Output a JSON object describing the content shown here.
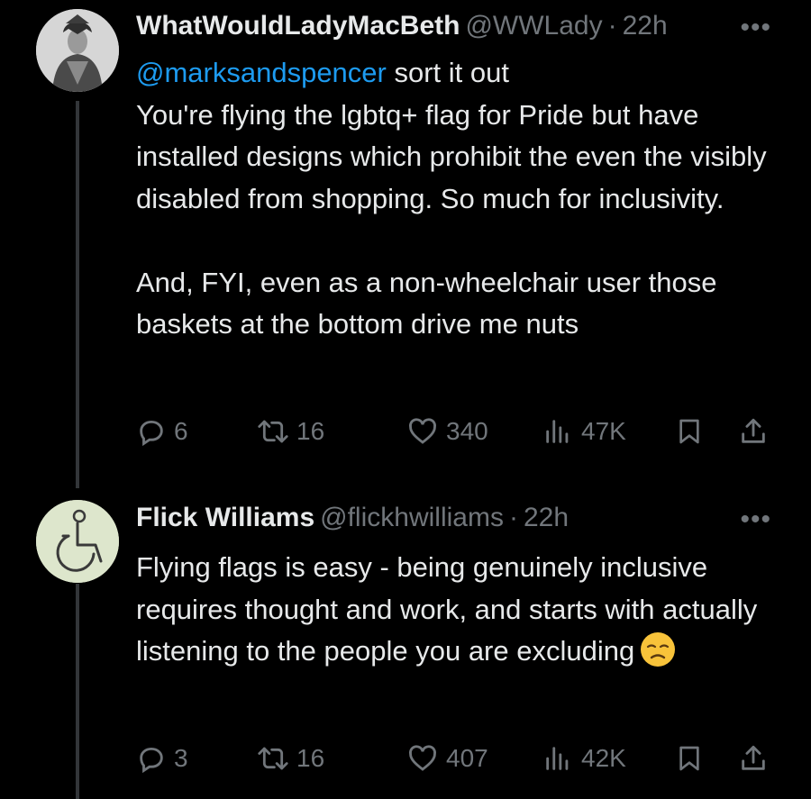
{
  "tweets": [
    {
      "name": "WhatWouldLadyMacBeth",
      "handle": "@WWLady",
      "separator": "·",
      "time": "22h",
      "more": "•••",
      "mention": "@marksandspencer",
      "text_line1_rest": " sort it out",
      "paragraphs": [
        "You're flying the lgbtq+ flag for Pride but have installed designs which prohibit the even the visibly disabled from shopping. So much for inclusivity.",
        "And, FYI, even as a non-wheelchair user those baskets at the bottom drive me nuts"
      ],
      "stats": {
        "replies": "6",
        "reposts": "16",
        "likes": "340",
        "views": "47K"
      }
    },
    {
      "name": "Flick Williams",
      "handle": "@flickhwilliams",
      "separator": "·",
      "time": "22h",
      "more": "•••",
      "text": "Flying flags is easy - being genuinely inclusive requires thought and work, and starts with actually listening to the people you are excluding",
      "emoji": "disappointed-face",
      "stats": {
        "replies": "3",
        "reposts": "16",
        "likes": "407",
        "views": "42K"
      }
    }
  ],
  "icons": {
    "reply": "reply-icon",
    "repost": "repost-icon",
    "like": "heart-icon",
    "views": "views-icon",
    "bookmark": "bookmark-icon",
    "share": "share-icon"
  },
  "colors": {
    "background": "#000000",
    "text": "#e7e9ea",
    "muted": "#71767b",
    "link": "#1d9bf0"
  }
}
